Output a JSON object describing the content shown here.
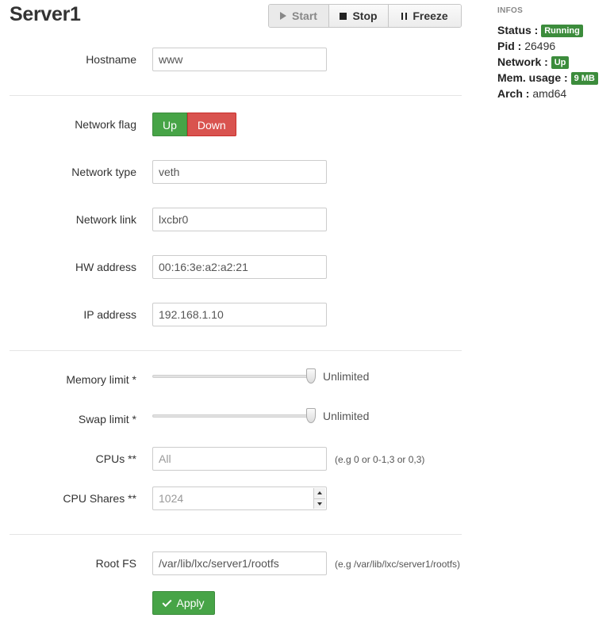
{
  "header": {
    "title": "Server1"
  },
  "toolbar": {
    "start_label": "Start",
    "stop_label": "Stop",
    "freeze_label": "Freeze"
  },
  "infos": {
    "heading": "INFOS",
    "status_key": "Status :",
    "status_value": "Running",
    "pid_key": "Pid :",
    "pid_value": "26496",
    "network_key": "Network :",
    "network_value": "Up",
    "mem_key": "Mem. usage :",
    "mem_value": "9 MB",
    "arch_key": "Arch :",
    "arch_value": "amd64",
    "badge_color": "#3c8c3c"
  },
  "form": {
    "hostname": {
      "label": "Hostname",
      "value": "www"
    },
    "network_flag": {
      "label": "Network flag",
      "up_label": "Up",
      "down_label": "Down",
      "up_color": "#47a447",
      "down_color": "#d9534f"
    },
    "network_type": {
      "label": "Network type",
      "value": "veth"
    },
    "network_link": {
      "label": "Network link",
      "value": "lxcbr0"
    },
    "hw_address": {
      "label": "HW address",
      "value": "00:16:3e:a2:a2:21"
    },
    "ip_address": {
      "label": "IP address",
      "value": "192.168.1.10"
    },
    "memory_limit": {
      "label": "Memory limit *",
      "value": "Unlimited",
      "level": 1.0
    },
    "swap_limit": {
      "label": "Swap limit *",
      "value": "Unlimited",
      "level": 1.0
    },
    "cpus": {
      "label": "CPUs **",
      "placeholder": "All",
      "hint": "(e.g 0 or 0-1,3 or 0,3)"
    },
    "cpu_shares": {
      "label": "CPU Shares **",
      "placeholder": "1024"
    },
    "root_fs": {
      "label": "Root FS",
      "value": "/var/lib/lxc/server1/rootfs",
      "hint": "(e.g /var/lib/lxc/server1/rootfs)"
    },
    "apply_label": "Apply"
  }
}
